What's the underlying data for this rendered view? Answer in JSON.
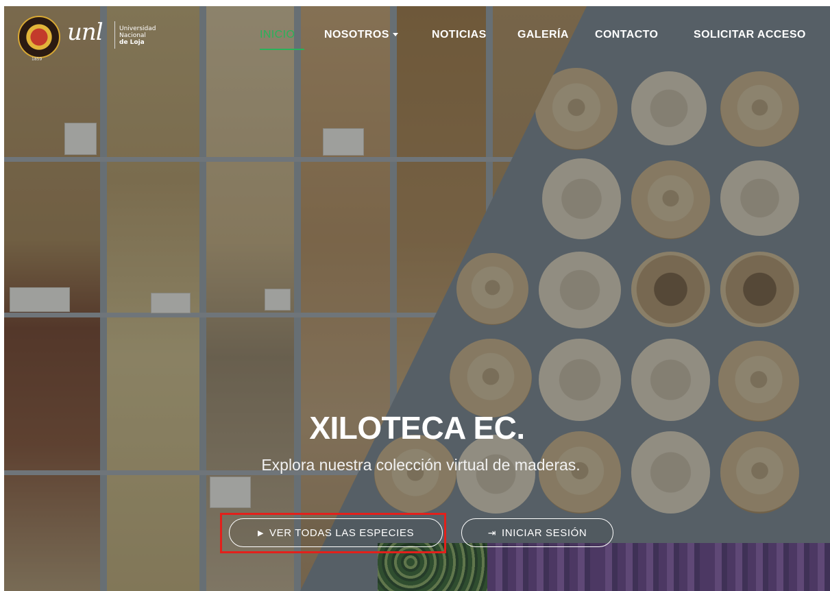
{
  "brand": {
    "seal_year": "1859",
    "unl_logo_text": "unl",
    "university_lines": [
      "Universidad",
      "Nacional",
      "de Loja"
    ]
  },
  "nav": {
    "items": [
      {
        "label": "INICIO",
        "active": true
      },
      {
        "label": "NOSOTROS",
        "has_dropdown": true
      },
      {
        "label": "NOTICIAS"
      },
      {
        "label": "GALERÍA"
      },
      {
        "label": "CONTACTO"
      },
      {
        "label": "SOLICITAR ACCESO"
      }
    ],
    "dropdown_icon": "caret-down-icon",
    "active_color": "#29b25a"
  },
  "hero": {
    "title": "XILOTECA EC.",
    "subtitle": "Explora nuestra colección virtual de maderas.",
    "buttons": [
      {
        "label": "VER TODAS LAS ESPECIES",
        "icon": "play-icon",
        "highlighted": true
      },
      {
        "label": "INICIAR SESIÓN",
        "icon": "sign-in-icon"
      }
    ],
    "highlight_color": "#e3201b"
  }
}
